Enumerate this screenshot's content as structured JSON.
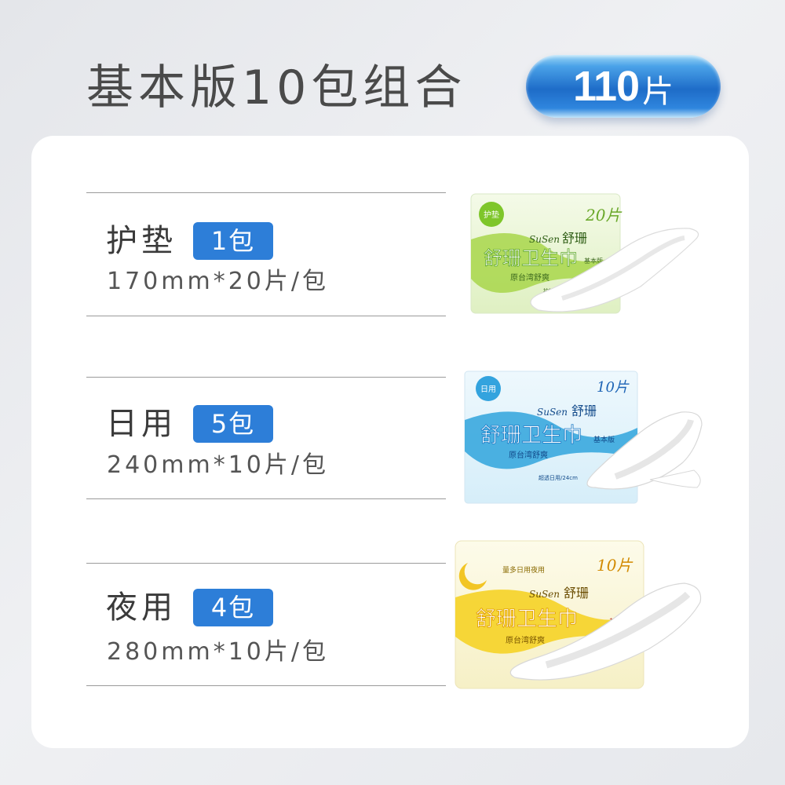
{
  "header": {
    "title": "基本版10包组合",
    "total_badge": {
      "number": "110",
      "unit": "片"
    }
  },
  "items": [
    {
      "name": "护垫",
      "count": "1包",
      "spec": "170mm*20片/包",
      "package": {
        "brand": "SuSen",
        "brand_cn": "舒珊",
        "product": "舒珊卫生巾",
        "tag": "护垫",
        "qty": "20片",
        "slogan": "原台湾舒爽",
        "edition": "基本版",
        "note": "护垫/17cm",
        "color": "#9ad23a"
      }
    },
    {
      "name": "日用",
      "count": "5包",
      "spec": "240mm*10片/包",
      "package": {
        "brand": "SuSen",
        "brand_cn": "舒珊",
        "product": "舒珊卫生巾",
        "tag": "日用",
        "qty": "10片",
        "slogan": "原台湾舒爽",
        "edition": "基本版",
        "note": "超透日用/24cm",
        "color": "#2aa0d8"
      }
    },
    {
      "name": "夜用",
      "count": "4包",
      "spec": "280mm*10片/包",
      "package": {
        "brand": "SuSen",
        "brand_cn": "舒珊",
        "product": "舒珊卫生巾",
        "tag": "量多日用夜用",
        "qty": "10片",
        "slogan": "原台湾舒爽",
        "edition": "基本版",
        "color": "#f2d23a"
      }
    }
  ]
}
